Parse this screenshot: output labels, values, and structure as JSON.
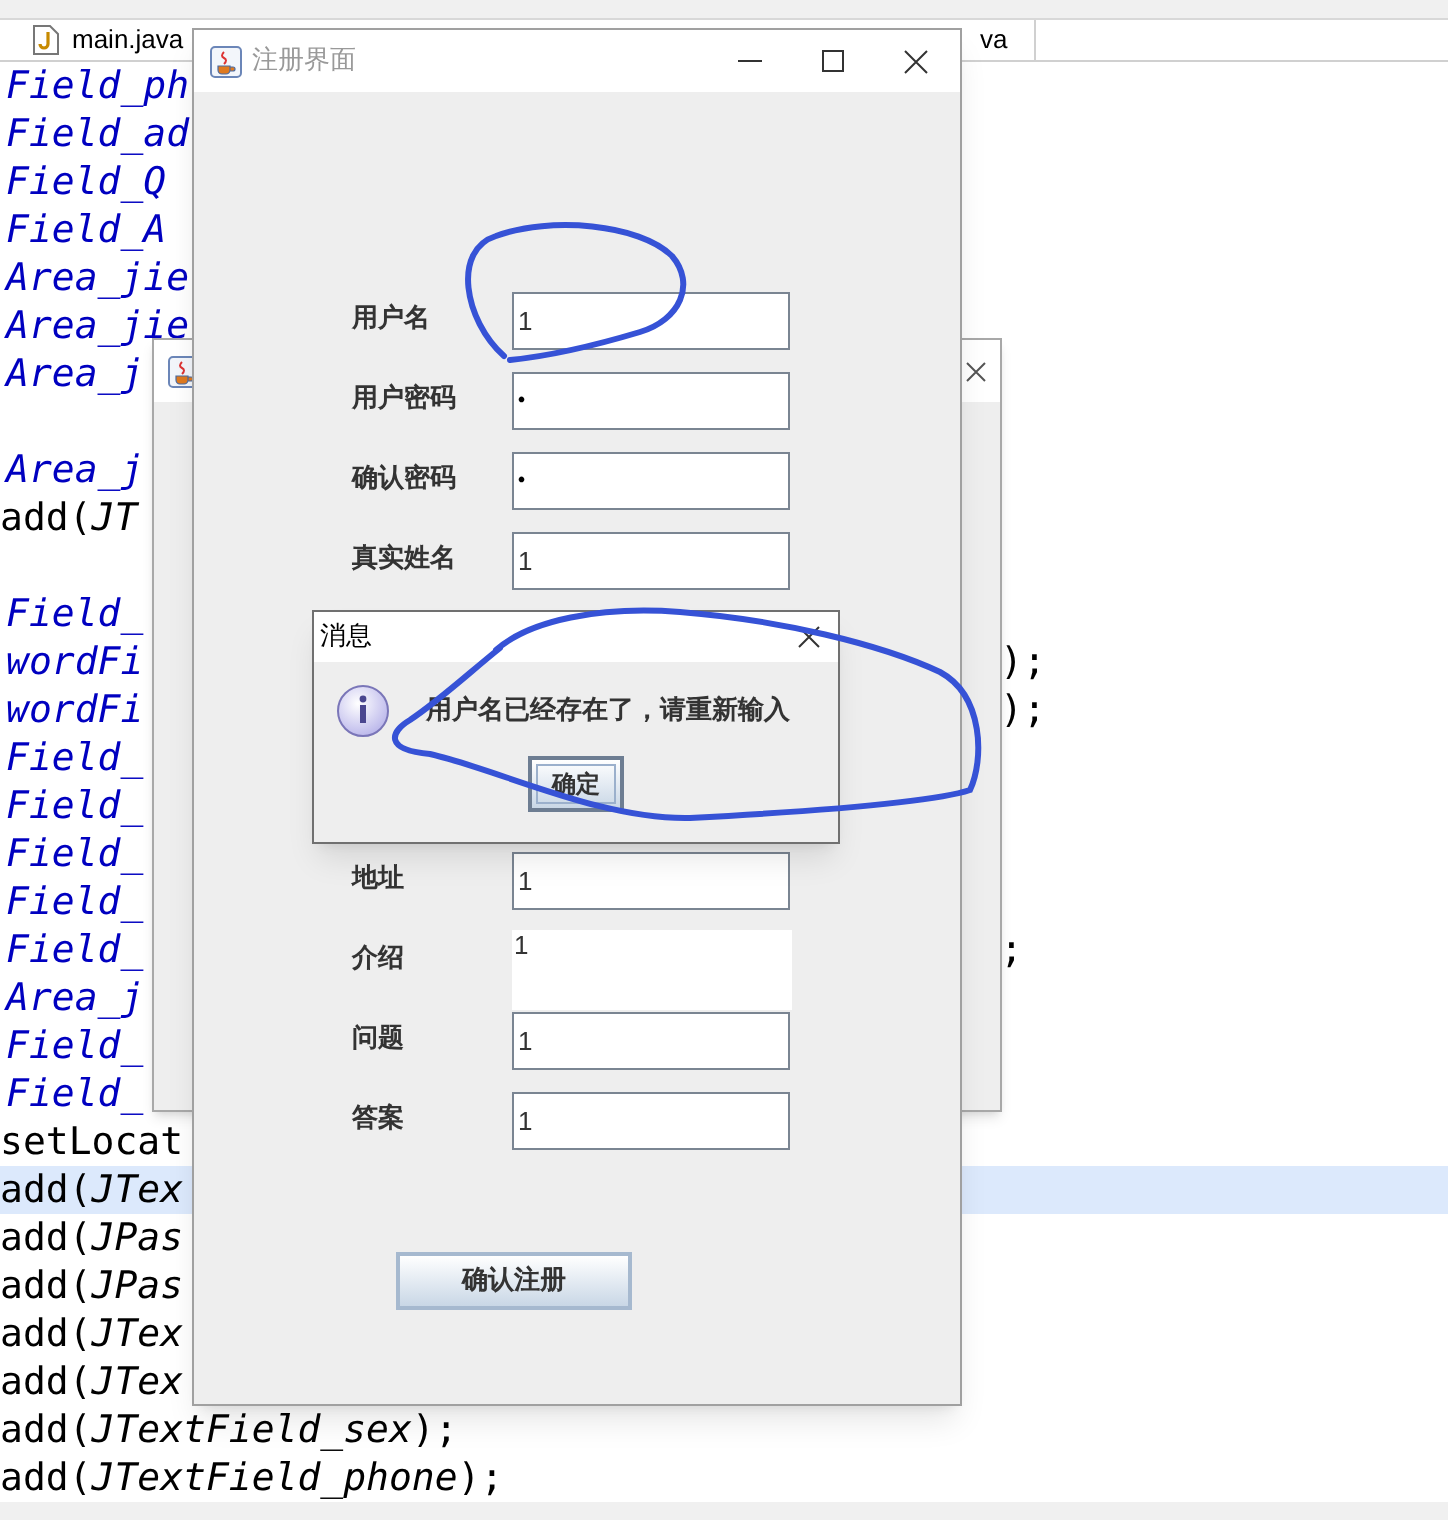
{
  "editor_tabs": [
    {
      "label": "main.java",
      "kind": "java"
    },
    {
      "label": "va",
      "kind": "plain"
    }
  ],
  "code_lines": [
    {
      "kind": "ident",
      "text": "Field_ph",
      "highlighted": false
    },
    {
      "kind": "ident",
      "text": "Field_ad",
      "highlighted": false
    },
    {
      "kind": "ident",
      "text": "Field_Q",
      "highlighted": false
    },
    {
      "kind": "ident",
      "text": "Field_A",
      "highlighted": false
    },
    {
      "kind": "ident",
      "text": "Area_jie",
      "highlighted": false
    },
    {
      "kind": "ident",
      "text": "Area_jie",
      "highlighted": false
    },
    {
      "kind": "ident",
      "text": "Area_j",
      "highlighted": false
    },
    {
      "kind": "blank",
      "highlighted": false
    },
    {
      "kind": "ident",
      "text": "Area_j",
      "highlighted": false
    },
    {
      "kind": "code",
      "text": "add(*JT*",
      "highlighted": false
    },
    {
      "kind": "blank",
      "highlighted": false
    },
    {
      "kind": "ident",
      "text": "Field_",
      "highlighted": false
    },
    {
      "kind": "ident",
      "text": "wordFi",
      "right": ");",
      "highlighted": false
    },
    {
      "kind": "ident",
      "text": "wordFi",
      "right": ");",
      "highlighted": false
    },
    {
      "kind": "ident",
      "text": "Field_",
      "highlighted": false
    },
    {
      "kind": "ident",
      "text": "Field_",
      "highlighted": false
    },
    {
      "kind": "ident",
      "text": "Field_",
      "highlighted": false
    },
    {
      "kind": "ident",
      "text": "Field_",
      "highlighted": false
    },
    {
      "kind": "ident",
      "text": "Field_",
      "right": ";",
      "highlighted": false
    },
    {
      "kind": "ident",
      "text": "Area_j",
      "highlighted": false
    },
    {
      "kind": "ident",
      "text": "Field_",
      "highlighted": false
    },
    {
      "kind": "ident",
      "text": "Field_",
      "highlighted": false
    },
    {
      "kind": "code",
      "text": "setLocat",
      "highlighted": false
    },
    {
      "kind": "code",
      "text": "add(*JTex*",
      "highlighted": true
    },
    {
      "kind": "code",
      "text": "add(*JPas*",
      "highlighted": false
    },
    {
      "kind": "code",
      "text": "add(*JPas*",
      "highlighted": false
    },
    {
      "kind": "code",
      "text": "add(*JTex*",
      "highlighted": false
    },
    {
      "kind": "code",
      "text": "add(*JTex*",
      "highlighted": false
    },
    {
      "kind": "code",
      "text": "add(*JTextField_sex*);",
      "highlighted": false
    },
    {
      "kind": "code",
      "text": "add(*JTextField_phone*);",
      "highlighted": false
    }
  ],
  "register_window": {
    "title": "注册界面",
    "fields_upper": [
      {
        "label": "用户名",
        "kind": "text",
        "value": "1"
      },
      {
        "label": "用户密码",
        "kind": "password",
        "value": "•"
      },
      {
        "label": "确认密码",
        "kind": "password",
        "value": "•"
      },
      {
        "label": "真实姓名",
        "kind": "text",
        "value": "1"
      }
    ],
    "fields_lower": [
      {
        "label": "地址",
        "kind": "text",
        "value": "1"
      },
      {
        "label": "介绍",
        "kind": "area",
        "value": "1"
      },
      {
        "label": "问题",
        "kind": "text",
        "value": "1"
      },
      {
        "label": "答案",
        "kind": "text",
        "value": "1"
      }
    ],
    "submit": "确认注册"
  },
  "message_dialog": {
    "title": "消息",
    "message": "用户名已经存在了，请重新输入",
    "ok": "确定"
  }
}
